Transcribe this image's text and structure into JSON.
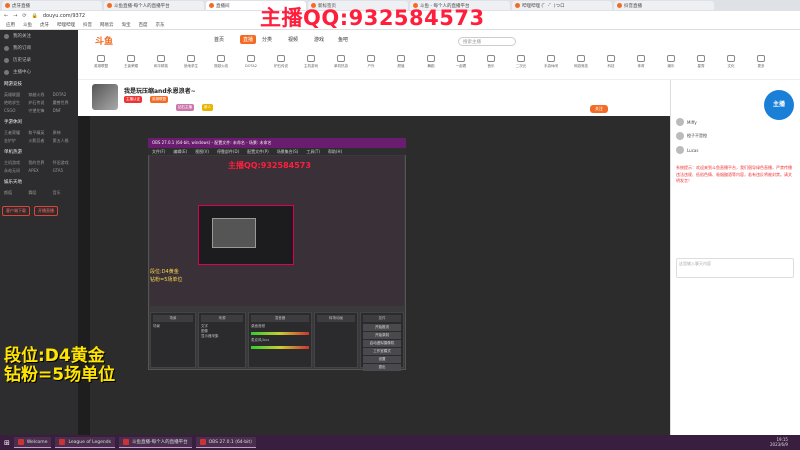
{
  "browser": {
    "tabs": [
      "虎牙直播",
      "斗鱼直播-每个人的直播平台",
      "直播间",
      "新标签页",
      "斗鱼 - 每个人的直播平台",
      "哔哩哔哩 (゜-゜)つロ",
      "抖音直播"
    ],
    "url": "douyu.com/9372",
    "bookmarks": [
      "应用",
      "斗鱼",
      "虎牙",
      "哔哩哔哩",
      "抖音",
      "网易云",
      "淘宝",
      "百度",
      "京东"
    ]
  },
  "watermark": "主播QQ:932584573",
  "site": {
    "logo": "斗鱼",
    "nav": [
      "首页",
      "直播",
      "分类",
      "视频",
      "游戏",
      "鱼吧"
    ],
    "nav_active_index": 1,
    "search_placeholder": "搜索主播",
    "categories": [
      "英雄联盟",
      "王者荣耀",
      "和平精英",
      "绝地求生",
      "穿越火线",
      "DOTA2",
      "炉石传说",
      "主机游戏",
      "单机热游",
      "户外",
      "颜值",
      "舞蹈",
      "一起看",
      "音乐",
      "二次元",
      "手游休闲",
      "网游竞技",
      "科技",
      "体育",
      "娱乐",
      "星秀",
      "文化",
      "更多"
    ]
  },
  "room": {
    "title": "我是玩压缩and永恩浪者~",
    "tags": [
      "主播认证",
      "英雄联盟",
      "钻石主播",
      "新人"
    ],
    "follow_label": "关注"
  },
  "sidebar": {
    "top_items": [
      "我的关注",
      "我的订阅",
      "历史记录",
      "主播中心"
    ],
    "sections": [
      {
        "title": "网游竞技",
        "items": [
          "英雄联盟",
          "穿越火线",
          "DOTA2",
          "绝地求生",
          "炉石传说",
          "魔兽世界",
          "CSGO",
          "守望先锋",
          "DNF"
        ]
      },
      {
        "title": "手游休闲",
        "items": [
          "王者荣耀",
          "和平精英",
          "原神",
          "金铲铲",
          "火影忍者",
          "第五人格"
        ]
      },
      {
        "title": "单机热游",
        "items": [
          "主机游戏",
          "我的世界",
          "怀旧游戏",
          "永劫无间",
          "APEX",
          "GTA5"
        ]
      },
      {
        "title": "娱乐天地",
        "items": [
          "颜值",
          "舞蹈",
          "音乐"
        ]
      }
    ],
    "bottom_buttons": [
      "客户端下载",
      "开播直播"
    ]
  },
  "obs": {
    "title": "OBS 27.0.1 (64-bit, windows) - 配置文件: 未命名 - 场景: 未命名",
    "menu": [
      "文件(F)",
      "编辑(E)",
      "视图(V)",
      "停靠部件(D)",
      "配置文件(P)",
      "场景集合(S)",
      "工具(T)",
      "帮助(H)"
    ],
    "docks": [
      "场景",
      "来源",
      "混音器",
      "转场动画",
      "控件"
    ],
    "scene": "场景",
    "sources": [
      "文字",
      "图像",
      "显示器采集"
    ],
    "mixer": [
      "桌面音频",
      "麦克风/Aux"
    ],
    "controls": [
      "开始推流",
      "开始录制",
      "启动虚拟摄像机",
      "工作室模式",
      "设置",
      "退出"
    ]
  },
  "overlay": {
    "rank_line1": "段位:D4黄金",
    "rank_line2": "钻粉=5场单位"
  },
  "chat": {
    "users": [
      "Miffy",
      "橙子不是橙",
      "Lucas"
    ],
    "notice": "系统提示：欢迎来到斗鱼直播平台，我们倡导绿色直播，严禁传播违法违规、低俗色情、吸烟酗酒等内容，若有违反将被封禁。请文明发言！",
    "input_placeholder": "这里输入聊天内容",
    "badge_text": "主播"
  },
  "taskbar": {
    "items": [
      "Welcome",
      "League of Legends",
      "斗鱼直播-每个人的直播平台",
      "OBS 27.0.1 (64-bit)"
    ],
    "time": "19:15",
    "date": "2023/6/9"
  }
}
